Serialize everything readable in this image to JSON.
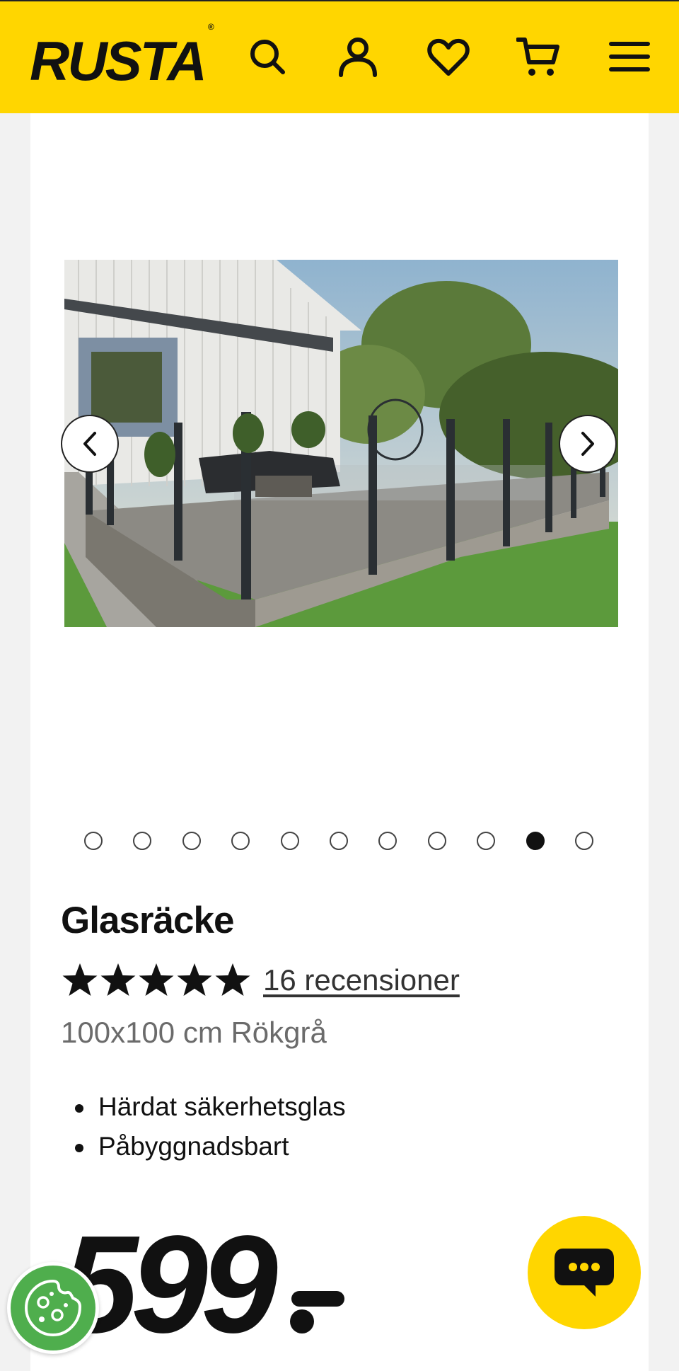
{
  "header": {
    "logo_text": "RUSTA",
    "logo_mark": "®",
    "icons": [
      "search-icon",
      "account-icon",
      "heart-icon",
      "cart-icon",
      "menu-icon"
    ],
    "brand_color": "#ffd600"
  },
  "gallery": {
    "image_alt": "Glasräcke på trädäck",
    "slide_count": 11,
    "active_slide_index": 9,
    "prev_icon": "chevron-left-icon",
    "next_icon": "chevron-right-icon"
  },
  "product": {
    "title": "Glasräcke",
    "rating": 5,
    "reviews_label": "16 recensioner",
    "variant": "100x100 cm Rökgrå",
    "features": [
      "Härdat säkerhetsglas",
      "Påbyggnadsbart"
    ],
    "price": "599"
  },
  "floating": {
    "chat_icon": "chat-icon",
    "cookie_icon": "cookie-icon"
  }
}
